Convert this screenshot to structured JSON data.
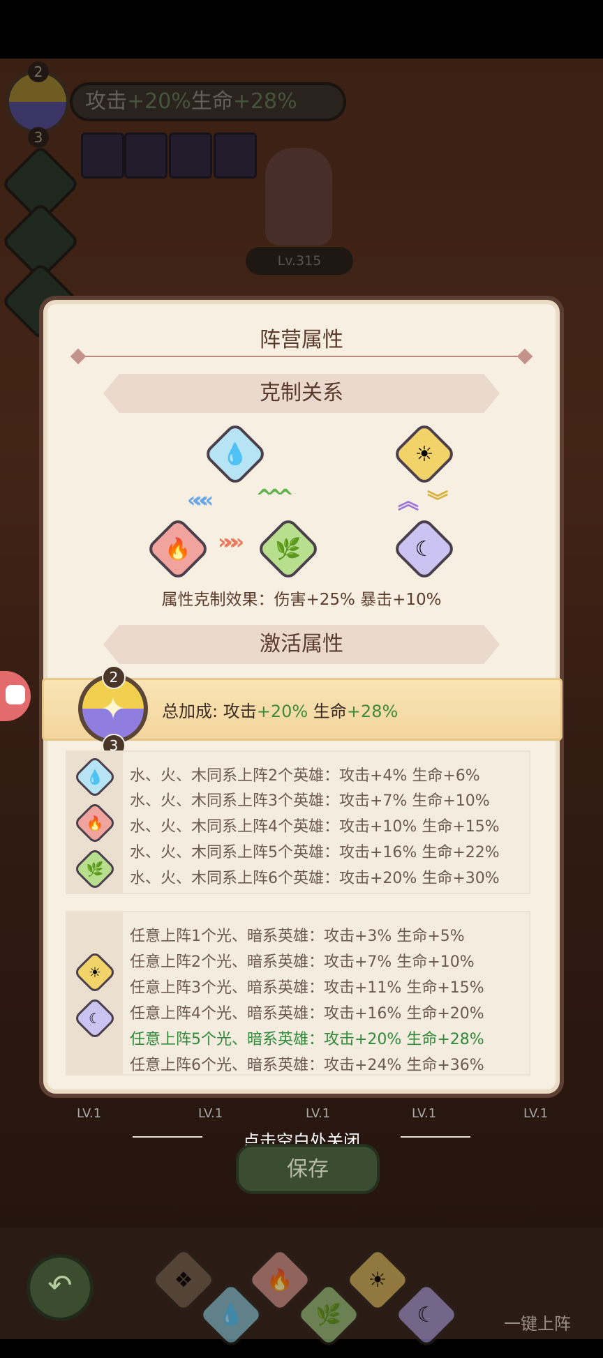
{
  "hud": {
    "top_num": "2",
    "bottom_num": "3",
    "bonus_label_atk": "攻击",
    "bonus_atk": "+20%",
    "bonus_label_hp": "生命",
    "bonus_hp": "+28%",
    "hero_level": "Lv.315"
  },
  "panel": {
    "title": "阵营属性",
    "counter_section": "克制关系",
    "counter_effect": "属性克制效果：伤害+25% 暴击+10%",
    "activate_section": "激活属性",
    "total": {
      "top_num": "2",
      "bottom_num": "3",
      "label": "总加成: 攻击",
      "atk": "+20%",
      "hp_label": " 生命",
      "hp": "+28%"
    },
    "group1": {
      "rows": [
        "水、火、木同系上阵2个英雄：攻击+4% 生命+6%",
        "水、火、木同系上阵3个英雄：攻击+7% 生命+10%",
        "水、火、木同系上阵4个英雄：攻击+10% 生命+15%",
        "水、火、木同系上阵5个英雄：攻击+16% 生命+22%",
        "水、火、木同系上阵6个英雄：攻击+20% 生命+30%"
      ]
    },
    "group2": {
      "rows": [
        "任意上阵1个光、暗系英雄：攻击+3% 生命+5%",
        "任意上阵2个光、暗系英雄：攻击+7% 生命+10%",
        "任意上阵3个光、暗系英雄：攻击+11% 生命+15%",
        "任意上阵4个光、暗系英雄：攻击+16% 生命+20%",
        "任意上阵5个光、暗系英雄：攻击+20% 生命+28%",
        "任意上阵6个光、暗系英雄：攻击+24% 生命+36%"
      ],
      "active_row_index": 4
    }
  },
  "bottom": {
    "close_hint": "点击空白处关闭",
    "save_label": "保存",
    "one_key_label": "一键上阵",
    "lv_label": "LV.1"
  },
  "icons": {
    "water": "water-drop-icon",
    "fire": "flame-icon",
    "wood": "leaf-icon",
    "light": "sun-icon",
    "dark": "moon-icon"
  },
  "colors": {
    "water": "#b6e4f4",
    "fire": "#f0a49d",
    "wood": "#b8df8e",
    "light": "#f2d36a",
    "dark": "#cbc3f1",
    "active_green": "#2f8a3a"
  }
}
